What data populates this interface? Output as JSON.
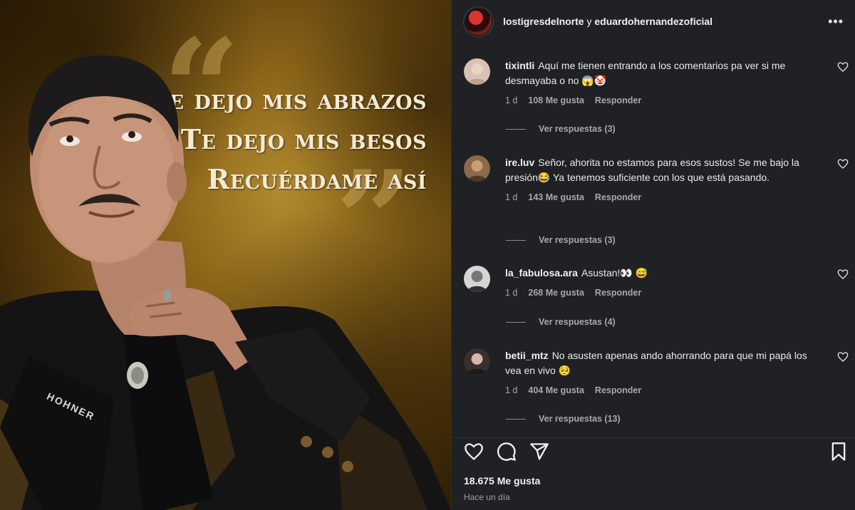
{
  "post": {
    "quote_lines": [
      "Te dejo mis abrazos",
      "Te dejo mis besos",
      "Recuérdame así"
    ],
    "portrait_brand": "HOHNER"
  },
  "header": {
    "account_1": "lostigresdelnorte",
    "conjunction": "y",
    "account_2": "eduardohernandezoficial",
    "more_icon": "more-horizontal-icon"
  },
  "comments": [
    {
      "user": "tixintli",
      "text": "Aquí me tienen entrando a los comentarios pa ver si me desmayaba o no 😱🤡",
      "time": "1 d",
      "likes": "108 Me gusta",
      "reply": "Responder",
      "view_replies": "Ver respuestas (3)"
    },
    {
      "user": "ire.luv",
      "text": "Señor, ahorita no estamos para esos sustos! Se me bajo la presión😂 Ya tenemos suficiente con los que está pasando.",
      "time": "1 d",
      "likes": "143 Me gusta",
      "reply": "Responder",
      "view_replies": "Ver respuestas (3)"
    },
    {
      "user": "la_fabulosa.ara",
      "text": "Asustan!👀 😅",
      "time": "1 d",
      "likes": "268 Me gusta",
      "reply": "Responder",
      "view_replies": "Ver respuestas (4)"
    },
    {
      "user": "betii_mtz",
      "text": "No asusten apenas ando ahorrando para que mi papá los vea en vivo 🥺",
      "time": "1 d",
      "likes": "404 Me gusta",
      "reply": "Responder",
      "view_replies": "Ver respuestas (13)"
    }
  ],
  "footer": {
    "likes": "18.675 Me gusta",
    "posted": "Hace un día"
  },
  "icons": [
    "heart-icon",
    "comment-icon",
    "share-icon",
    "bookmark-icon"
  ],
  "colors": {
    "sidebar_bg": "#1f2124",
    "image_gold": "#8b6418",
    "text_primary": "#f1f1f1",
    "text_secondary": "#a8a8a8"
  }
}
